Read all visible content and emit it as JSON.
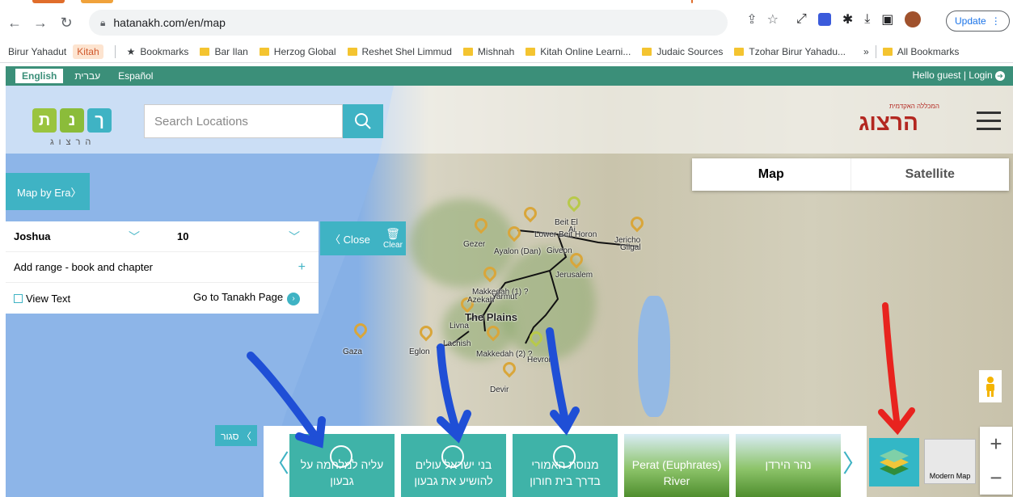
{
  "browser": {
    "url": "hatanakh.com/en/map",
    "update_label": "Update",
    "bookmarks": [
      {
        "label": "Birur Yahadut"
      },
      {
        "label": "Kitah"
      },
      {
        "label": "Bookmarks"
      },
      {
        "label": "Bar Ilan"
      },
      {
        "label": "Herzog Global"
      },
      {
        "label": "Reshet Shel Limmud"
      },
      {
        "label": "Mishnah"
      },
      {
        "label": "Kitah Online Learni..."
      },
      {
        "label": "Judaic Sources"
      },
      {
        "label": "Tzohar Birur Yahadu..."
      },
      {
        "label": "»"
      },
      {
        "label": "All Bookmarks"
      }
    ]
  },
  "site": {
    "languages": [
      "English",
      "עברית",
      "Español"
    ],
    "greeting": "Hello guest | Login",
    "logo_letters": [
      "ת",
      "נ",
      "ך"
    ],
    "logo_sub": "הרצוג",
    "search_placeholder": "Search Locations",
    "herzog_logo": "הרצוג",
    "herzog_sub": "המכללה האקדמית"
  },
  "map_toggle": {
    "map": "Map",
    "satellite": "Satellite"
  },
  "era_button": "Map by Era〉",
  "panel": {
    "book": "Joshua",
    "chapter": "10",
    "add_range": "Add range - book and chapter",
    "add_icon": "+",
    "view_text": "View Text",
    "goto_page": "Go to Tanakh Page",
    "close_label": "〈 Close",
    "clear_label": "Clear"
  },
  "places": [
    {
      "name": "Beit El"
    },
    {
      "name": "Ai"
    },
    {
      "name": "Lower Beit Horon"
    },
    {
      "name": "Gezer"
    },
    {
      "name": "Ayalon (Dan)"
    },
    {
      "name": "Giveon"
    },
    {
      "name": "Jericho"
    },
    {
      "name": "Gilgal"
    },
    {
      "name": "Jerusalem"
    },
    {
      "name": "Makkedah (1) ?"
    },
    {
      "name": "Azekah"
    },
    {
      "name": "Yarmut"
    },
    {
      "name": "The Plains"
    },
    {
      "name": "Livna"
    },
    {
      "name": "Gaza"
    },
    {
      "name": "Eglon"
    },
    {
      "name": "Lachish"
    },
    {
      "name": "Makkedah (2) ?"
    },
    {
      "name": "Hevron"
    },
    {
      "name": "Devir"
    }
  ],
  "bottom": {
    "close_strip": "סגור 〈",
    "cards": [
      {
        "line1": "עליה למלחמה על",
        "line2": "גבעון",
        "style": "teal"
      },
      {
        "line1": "בני ישראל עולים",
        "line2": "להושיע את גבעון",
        "style": "teal"
      },
      {
        "line1": "מנוסת האמורי",
        "line2": "בדרך בית חורון",
        "style": "teal"
      },
      {
        "line1": "Perat (Euphrates)",
        "line2": "River",
        "style": "green"
      },
      {
        "line1": "",
        "line2": "נהר הירדן",
        "style": "green"
      }
    ],
    "modern_map": "Modern Map",
    "zoom_in": "+",
    "zoom_out": "−"
  }
}
